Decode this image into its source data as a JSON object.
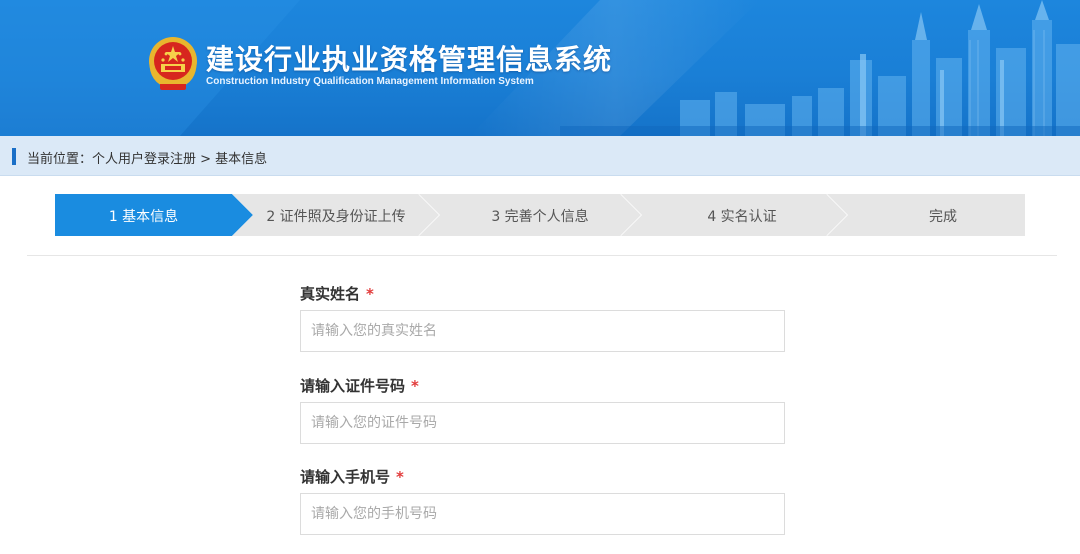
{
  "header": {
    "title_cn": "建设行业执业资格管理信息系统",
    "title_en": "Construction Industry Qualification Management Information System"
  },
  "breadcrumb": {
    "text": "当前位置：个人用户登录注册 > 基本信息"
  },
  "steps": [
    {
      "label": "1 基本信息",
      "active": true
    },
    {
      "label": "2 证件照及身份证上传",
      "active": false
    },
    {
      "label": "3 完善个人信息",
      "active": false
    },
    {
      "label": "4 实名认证",
      "active": false
    },
    {
      "label": "完成",
      "active": false
    }
  ],
  "form": {
    "name": {
      "label": "真实姓名",
      "required_mark": "*",
      "placeholder": "请输入您的真实姓名"
    },
    "id_number": {
      "label": "请输入证件号码",
      "required_mark": "*",
      "placeholder": "请输入您的证件号码"
    },
    "phone": {
      "label": "请输入手机号",
      "required_mark": "*",
      "placeholder": "请输入您的手机号码"
    }
  },
  "colors": {
    "header_blue": "#1a7fd6",
    "step_active": "#1a8ce0",
    "step_inactive": "#e6e6e6",
    "required": "#e23b3b",
    "breadcrumb_bg": "#dbe9f7"
  }
}
